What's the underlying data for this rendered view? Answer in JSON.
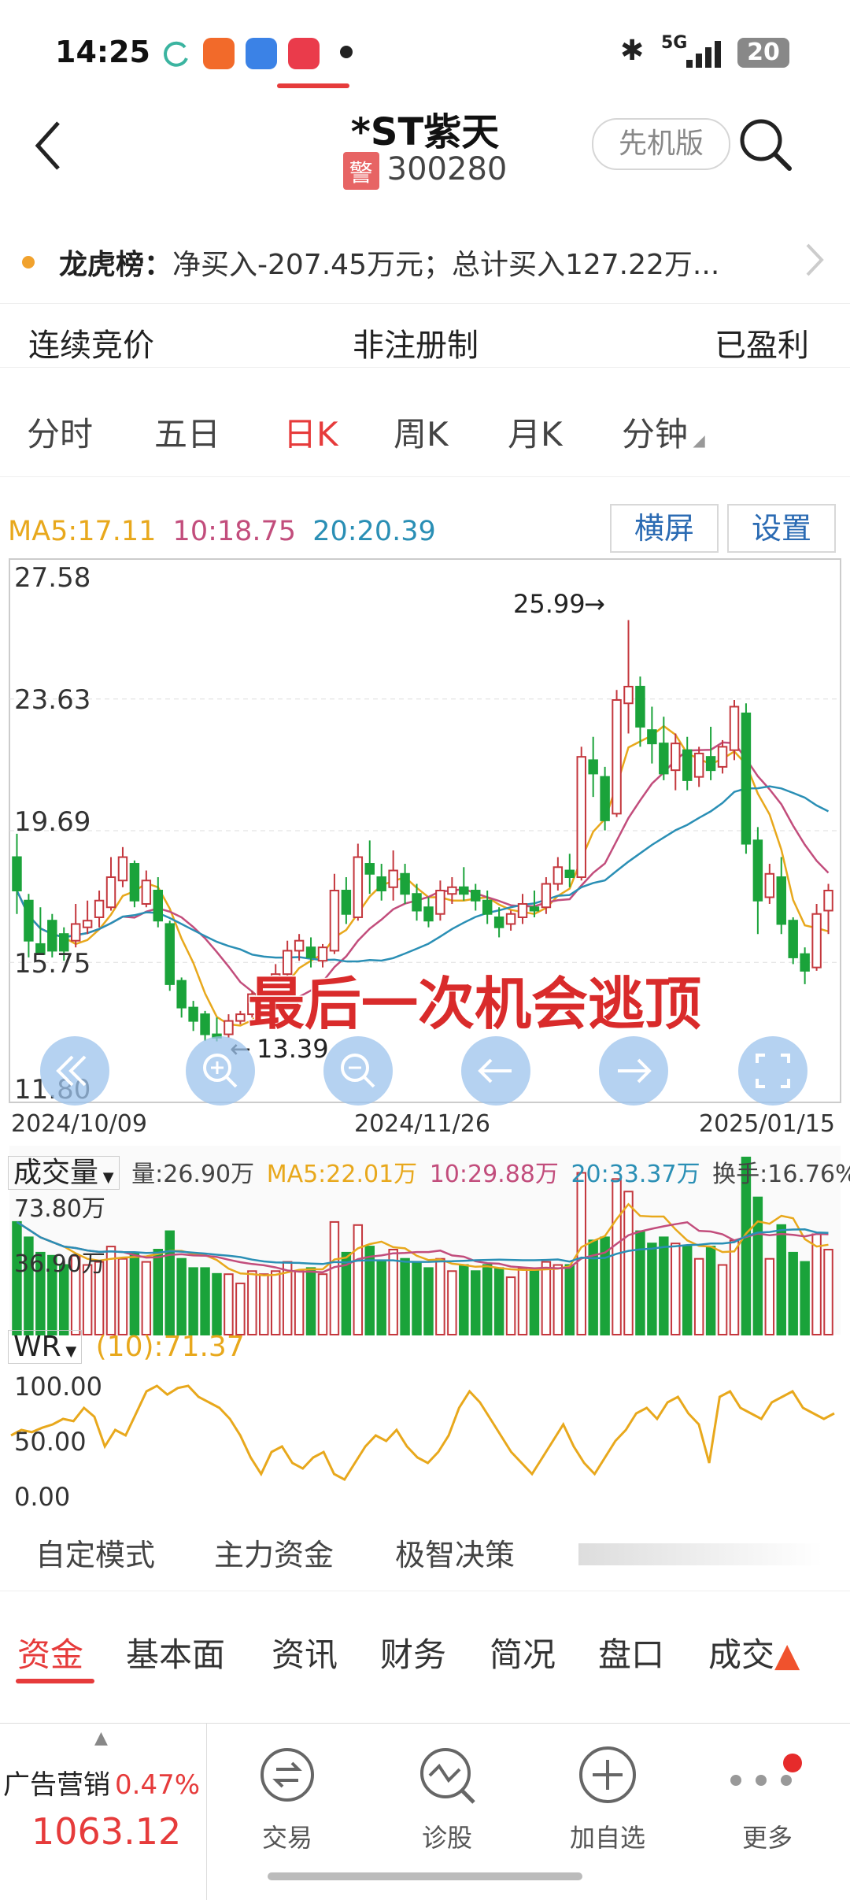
{
  "status": {
    "time": "14:25",
    "network": "5G",
    "battery": "20"
  },
  "header": {
    "stock_name": "*ST紫天",
    "warn_badge": "警",
    "stock_code": "300280",
    "version_button": "先机版"
  },
  "longhubang": {
    "label": "龙虎榜：",
    "text": "净买入-207.45万元；总计买入127.22万..."
  },
  "tags": [
    "连续竞价",
    "非注册制",
    "已盈利"
  ],
  "kline_tabs": [
    "分时",
    "五日",
    "日K",
    "周K",
    "月K",
    "分钟"
  ],
  "active_kline_tab": "日K",
  "ma": {
    "ma5": "MA5:17.11",
    "ma10": "10:18.75",
    "ma20": "20:20.39"
  },
  "buttons": {
    "landscape": "横屏",
    "settings": "设置"
  },
  "price_axis": [
    "27.58",
    "23.63",
    "19.69",
    "15.75",
    "11.80"
  ],
  "date_axis": [
    "2024/10/09",
    "2024/11/26",
    "2025/01/15"
  ],
  "annotations": {
    "high": "25.99",
    "low": "13.39",
    "overlay_text": "最后一次机会逃顶"
  },
  "volume": {
    "label": "成交量",
    "vol": "量:26.90万",
    "ma5": "MA5:22.01万",
    "ma10": "10:29.88万",
    "ma20": "20:33.37万",
    "turnover": "换手:16.76%",
    "axis_top": "73.80万",
    "axis_mid": "36.90万"
  },
  "wr": {
    "label": "WR",
    "value": "(10):71.37",
    "axis": [
      "100.00",
      "50.00",
      "0.00"
    ]
  },
  "modes": [
    "自定模式",
    "主力资金",
    "极智决策"
  ],
  "bottom_tabs": [
    "资金",
    "基本面",
    "资讯",
    "财务",
    "简况",
    "盘口",
    "成交"
  ],
  "active_bottom_tab": "资金",
  "footer": {
    "sector_name": "广告营销",
    "sector_change": "0.47%",
    "sector_value": "1063.12",
    "nav": [
      "交易",
      "诊股",
      "加自选",
      "更多"
    ]
  },
  "colors": {
    "up": "#c4373d",
    "down": "#1aa33a",
    "ma5": "#e8a81c",
    "ma10": "#c24d7c",
    "ma20": "#2a8fb5",
    "accent": "#e63b3b"
  },
  "chart_data": {
    "type": "candlestick",
    "x_start": "2024/10/09",
    "x_end": "2025/01/15",
    "ylim": [
      11.8,
      27.58
    ],
    "candles": [
      [
        18.9,
        19.6,
        17.9,
        17.2
      ],
      [
        17.6,
        17.8,
        16.4,
        15.9
      ],
      [
        16.3,
        17.4,
        16.0,
        16.0
      ],
      [
        17.0,
        17.2,
        16.1,
        15.9
      ],
      [
        16.6,
        16.8,
        16.1,
        15.8
      ],
      [
        16.4,
        17.5,
        16.9,
        16.2
      ],
      [
        16.8,
        17.6,
        17.0,
        16.6
      ],
      [
        17.1,
        17.9,
        17.6,
        16.8
      ],
      [
        17.4,
        18.9,
        18.3,
        17.3
      ],
      [
        18.2,
        19.2,
        18.9,
        18.0
      ],
      [
        18.7,
        18.8,
        17.6,
        17.4
      ],
      [
        17.5,
        18.5,
        18.2,
        17.4
      ],
      [
        17.9,
        18.3,
        17.0,
        16.8
      ],
      [
        16.9,
        17.0,
        15.1,
        14.9
      ],
      [
        15.2,
        15.3,
        14.4,
        14.1
      ],
      [
        14.4,
        14.6,
        14.0,
        13.7
      ],
      [
        14.2,
        14.3,
        13.6,
        13.4
      ],
      [
        13.6,
        14.1,
        13.5,
        13.39
      ],
      [
        13.6,
        14.2,
        14.0,
        13.5
      ],
      [
        14.0,
        14.3,
        14.2,
        13.9
      ],
      [
        14.2,
        14.9,
        14.8,
        14.1
      ],
      [
        14.8,
        15.3,
        15.2,
        14.6
      ],
      [
        15.1,
        15.7,
        15.4,
        14.9
      ],
      [
        15.4,
        16.4,
        16.1,
        15.3
      ],
      [
        16.1,
        16.6,
        16.4,
        15.8
      ],
      [
        16.2,
        16.5,
        15.9,
        15.6
      ],
      [
        15.8,
        16.3,
        16.2,
        15.6
      ],
      [
        16.1,
        18.4,
        17.9,
        16.0
      ],
      [
        17.9,
        18.3,
        17.2,
        16.9
      ],
      [
        17.1,
        19.3,
        18.9,
        17.0
      ],
      [
        18.7,
        19.4,
        18.4,
        17.8
      ],
      [
        18.3,
        18.7,
        17.9,
        17.6
      ],
      [
        18.0,
        19.1,
        18.5,
        17.6
      ],
      [
        18.4,
        18.7,
        17.8,
        17.5
      ],
      [
        17.8,
        18.1,
        17.3,
        17.0
      ],
      [
        17.4,
        17.7,
        17.0,
        16.8
      ],
      [
        17.2,
        18.2,
        17.9,
        17.0
      ],
      [
        17.8,
        18.3,
        18.0,
        17.5
      ],
      [
        18.0,
        18.6,
        17.8,
        17.6
      ],
      [
        17.9,
        18.1,
        17.6,
        17.3
      ],
      [
        17.6,
        17.9,
        17.2,
        16.9
      ],
      [
        17.1,
        17.4,
        16.8,
        16.5
      ],
      [
        16.9,
        17.3,
        17.2,
        16.7
      ],
      [
        17.1,
        17.8,
        17.5,
        16.9
      ],
      [
        17.4,
        17.9,
        17.3,
        17.1
      ],
      [
        17.4,
        18.3,
        18.1,
        17.2
      ],
      [
        18.1,
        18.9,
        18.6,
        17.9
      ],
      [
        18.5,
        19.0,
        18.3,
        18.0
      ],
      [
        18.3,
        22.2,
        21.9,
        18.2
      ],
      [
        21.8,
        22.5,
        21.4,
        20.7
      ],
      [
        21.3,
        21.6,
        20.0,
        19.7
      ],
      [
        20.2,
        23.9,
        23.6,
        20.1
      ],
      [
        23.5,
        25.99,
        24.0,
        22.6
      ],
      [
        24.0,
        24.3,
        22.8,
        22.2
      ],
      [
        22.7,
        23.4,
        22.3,
        21.7
      ],
      [
        22.3,
        23.1,
        21.4,
        21.2
      ],
      [
        21.5,
        22.6,
        22.3,
        20.9
      ],
      [
        22.1,
        22.5,
        21.2,
        20.9
      ],
      [
        21.3,
        22.2,
        22.0,
        21.0
      ],
      [
        21.9,
        22.8,
        21.5,
        21.2
      ],
      [
        21.6,
        22.4,
        22.2,
        21.4
      ],
      [
        22.1,
        23.6,
        23.4,
        21.8
      ],
      [
        23.2,
        23.5,
        19.3,
        19.0
      ],
      [
        19.4,
        19.8,
        17.6,
        16.6
      ],
      [
        17.7,
        18.7,
        18.4,
        17.5
      ],
      [
        18.3,
        18.9,
        16.9,
        16.6
      ],
      [
        17.0,
        17.1,
        15.9,
        15.7
      ],
      [
        16.0,
        16.2,
        15.5,
        15.1
      ],
      [
        15.6,
        17.5,
        17.2,
        15.5
      ],
      [
        17.3,
        18.1,
        17.9,
        16.6
      ]
    ],
    "wr": [
      55,
      60,
      58,
      62,
      65,
      70,
      68,
      80,
      72,
      45,
      60,
      55,
      75,
      95,
      100,
      92,
      98,
      100,
      90,
      85,
      80,
      70,
      55,
      35,
      20,
      40,
      45,
      30,
      25,
      35,
      40,
      20,
      15,
      30,
      45,
      55,
      50,
      60,
      45,
      35,
      30,
      40,
      55,
      80,
      95,
      85,
      70,
      55,
      40,
      30,
      20,
      35,
      50,
      65,
      45,
      30,
      20,
      35,
      50,
      60,
      75,
      80,
      70,
      85,
      90,
      75,
      65,
      30,
      90,
      95,
      80,
      75,
      70,
      85,
      90,
      95,
      80,
      75,
      70,
      75
    ]
  }
}
